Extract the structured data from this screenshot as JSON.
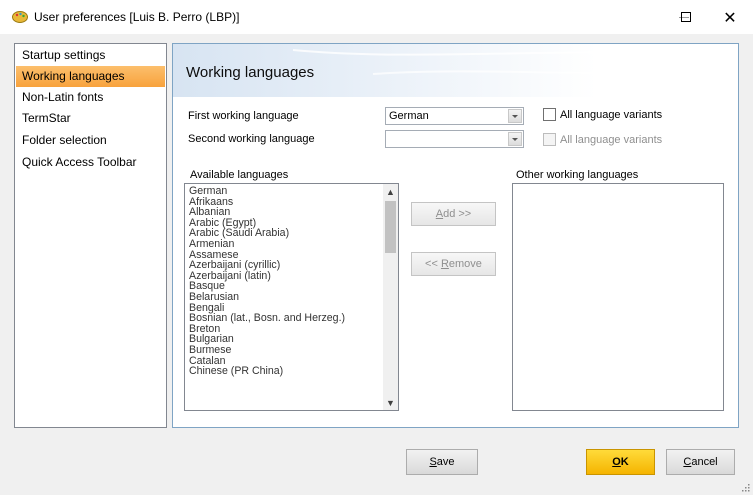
{
  "window": {
    "title": "User preferences [Luis B. Perro (LBP)]",
    "icon": "palette-icon",
    "controls": {
      "minimize": "minimize",
      "maximize": "maximize",
      "close": "close"
    }
  },
  "sidebar": {
    "items": [
      {
        "label": "Startup settings",
        "active": false
      },
      {
        "label": "Working languages",
        "active": true
      },
      {
        "label": "Non-Latin fonts",
        "active": false
      },
      {
        "label": "TermStar",
        "active": false
      },
      {
        "label": "Folder selection",
        "active": false
      },
      {
        "label": "Quick Access Toolbar",
        "active": false
      }
    ]
  },
  "panel": {
    "title": "Working languages",
    "first_language_label": "First working language",
    "first_language_value": "German",
    "second_language_label": "Second working language",
    "second_language_value": "",
    "all_variants_1": {
      "label": "All language variants",
      "checked": false,
      "enabled": true
    },
    "all_variants_2": {
      "label": "All language variants",
      "checked": false,
      "enabled": false
    },
    "available_label": "Available languages",
    "other_label": "Other working languages",
    "available_languages": [
      "German",
      "Afrikaans",
      "Albanian",
      "Arabic (Egypt)",
      "Arabic (Saudi Arabia)",
      "Armenian",
      "Assamese",
      "Azerbaijani (cyrillic)",
      "Azerbaijani (latin)",
      "Basque",
      "Belarusian",
      "Bengali",
      "Bosnian (lat., Bosn. and Herzeg.)",
      "Breton",
      "Bulgarian",
      "Burmese",
      "Catalan",
      "Chinese (PR China)"
    ],
    "other_languages": [],
    "add_button": {
      "mnemonic": "A",
      "rest": "dd >>"
    },
    "remove_button": {
      "prefix": "<< ",
      "mnemonic": "R",
      "rest": "emove"
    }
  },
  "footer": {
    "save_button": {
      "mnemonic": "S",
      "rest": "ave"
    },
    "ok_button": {
      "mnemonic": "O",
      "rest": "K"
    },
    "cancel_button": {
      "mnemonic": "C",
      "rest": "ancel"
    }
  },
  "colors": {
    "sidebar_active": "#f8a23c",
    "ok_button": "#f5b400",
    "panel_border": "#7fa4c4"
  }
}
